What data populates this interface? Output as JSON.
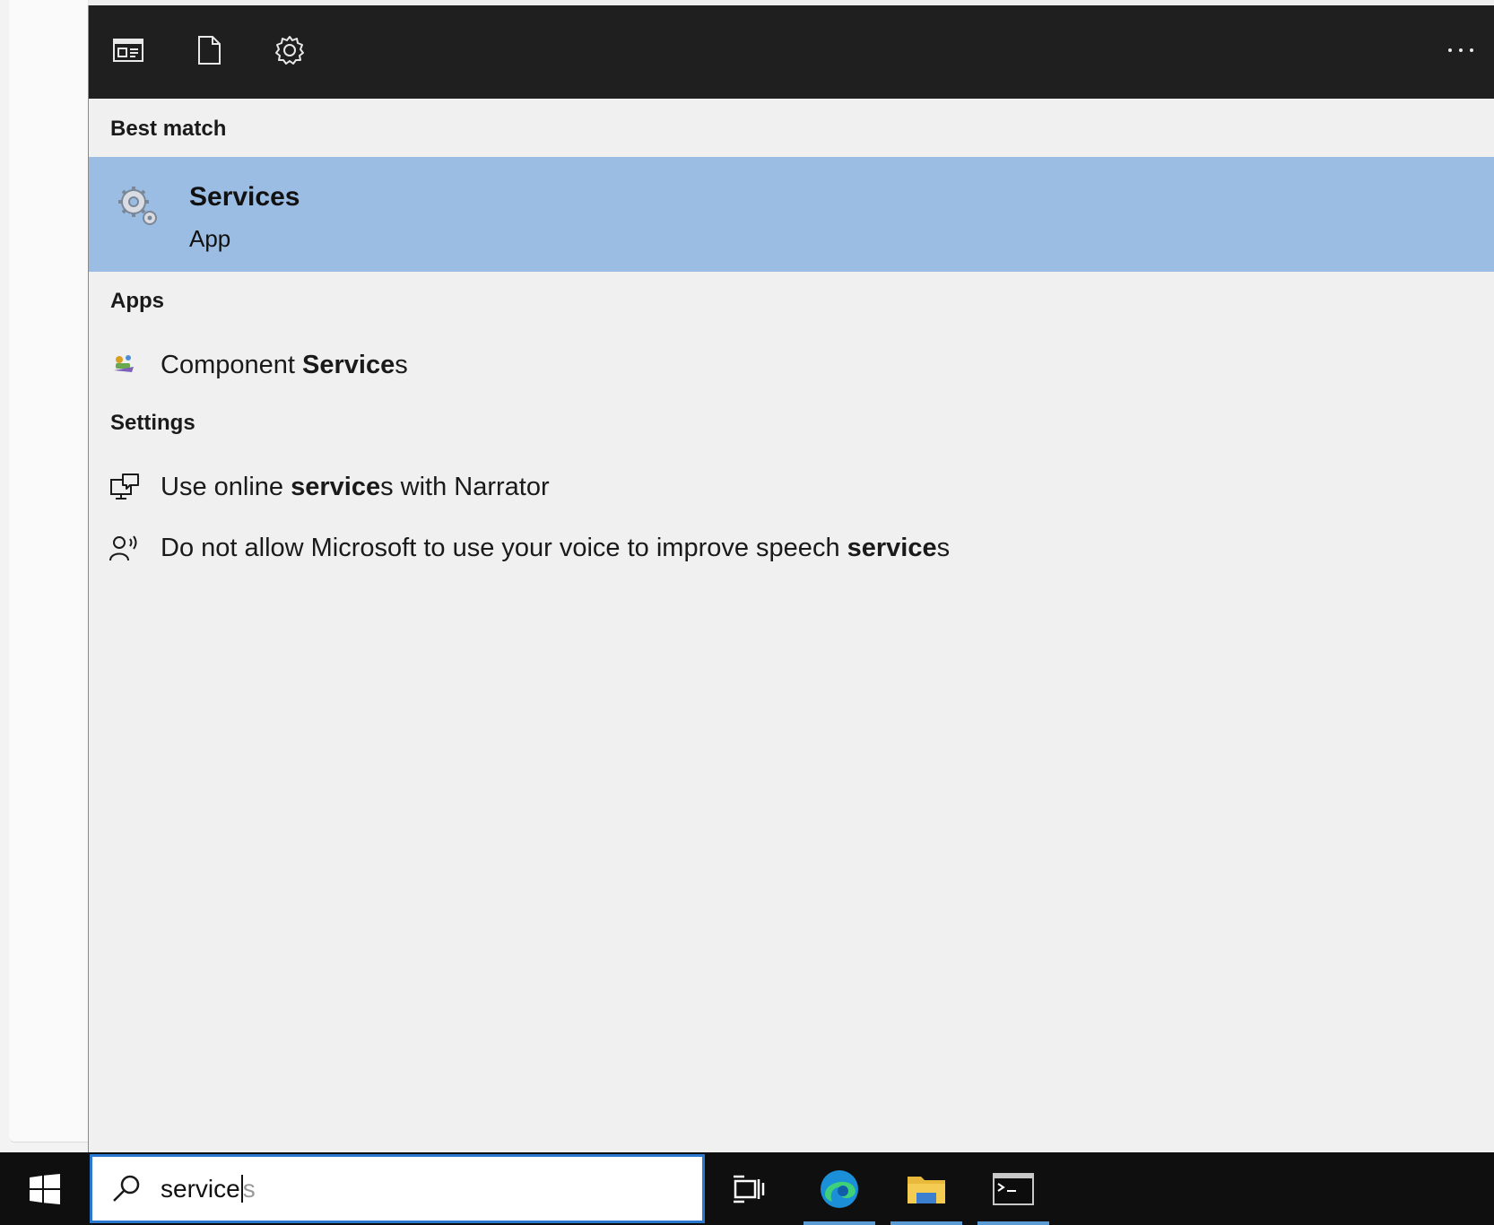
{
  "toolbar": {
    "icons": [
      "app-view-icon",
      "document-icon",
      "settings-gear-icon",
      "more-options-icon"
    ],
    "more_label": "···"
  },
  "best_match": {
    "heading": "Best match",
    "title": "Services",
    "subtitle": "App",
    "icon": "services-gear-icon"
  },
  "apps": {
    "heading": "Apps",
    "items": [
      {
        "prefix": "Component ",
        "bold": "Service",
        "suffix": "s",
        "icon": "component-services-icon"
      }
    ]
  },
  "settings": {
    "heading": "Settings",
    "items": [
      {
        "prefix": "Use online ",
        "bold": "service",
        "suffix": "s with Narrator",
        "icon": "narrator-monitor-icon"
      },
      {
        "prefix": "Do not allow Microsoft to use your voice to improve speech ",
        "bold": "service",
        "suffix": "s",
        "icon": "speech-person-icon"
      }
    ]
  },
  "taskbar": {
    "search_query": "service",
    "search_ghost": "s",
    "apps": [
      "task-view-icon",
      "edge-browser-icon",
      "file-explorer-icon",
      "command-prompt-icon"
    ]
  },
  "colors": {
    "toolbar_bg": "#1f1f1f",
    "panel_bg": "#f0f0f0",
    "highlight": "#9bbde3",
    "taskbar_bg": "#0f0f0f",
    "accent": "#2b78d0"
  }
}
